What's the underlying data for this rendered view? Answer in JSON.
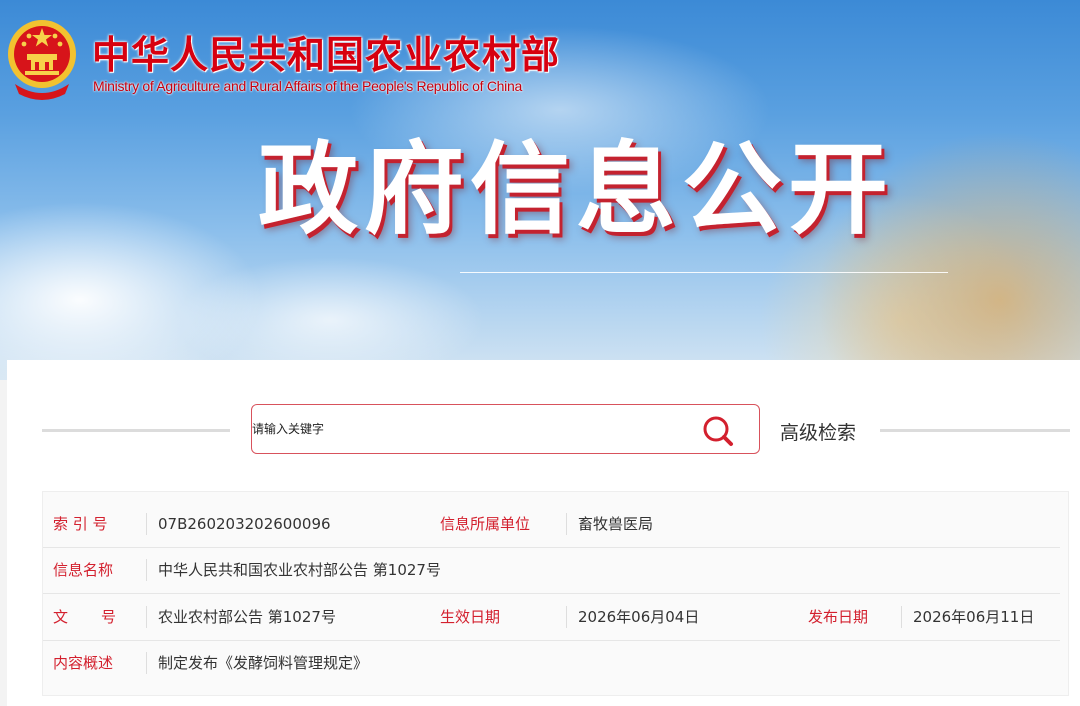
{
  "header": {
    "ministry_name_cn": "中华人民共和国农业农村部",
    "ministry_name_en": "Ministry of Agriculture and Rural Affairs of the People's Republic of China",
    "emblem_icon": "national-emblem-icon",
    "hero_title": "政府信息公开"
  },
  "search": {
    "placeholder": "请输入关键字",
    "search_icon": "search-icon",
    "advanced_label": "高级检索"
  },
  "info": {
    "index_label": "索 引 号",
    "index_value": "07B260203202600096",
    "unit_label": "信息所属单位",
    "unit_value": "畜牧兽医局",
    "name_label": "信息名称",
    "name_value": "中华人民共和国农业农村部公告 第1027号",
    "doc_label_1": "文",
    "doc_label_2": "号",
    "doc_value": "农业农村部公告 第1027号",
    "effective_label": "生效日期",
    "effective_value": "2026年06月04日",
    "publish_label": "发布日期",
    "publish_value": "2026年06月11日",
    "summary_label": "内容概述",
    "summary_value": "制定发布《发酵饲料管理规定》"
  },
  "colors": {
    "accent_red": "#d3202e",
    "title_red": "#d7000f"
  }
}
